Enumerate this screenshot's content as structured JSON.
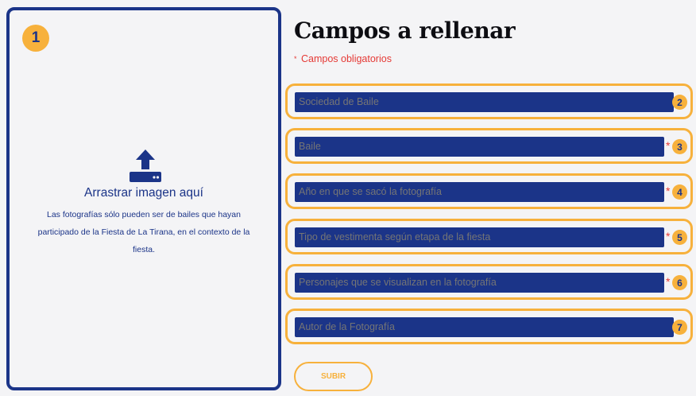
{
  "dropzone": {
    "step": "1",
    "icon": "upload-icon",
    "title": "Arrastrar imagen aquí",
    "hint": "Las fotografías sólo pueden ser de bailes que hayan participado de la Fiesta de La Tirana, en el contexto de la fiesta."
  },
  "form": {
    "title": "Campos a rellenar",
    "required_mark": "*",
    "required_note": "Campos obligatorios",
    "fields": [
      {
        "step": "2",
        "placeholder": "Sociedad de Baile",
        "required": false
      },
      {
        "step": "3",
        "placeholder": "Baile",
        "required": true
      },
      {
        "step": "4",
        "placeholder": "Año en que se sacó la fotografía",
        "required": true
      },
      {
        "step": "5",
        "placeholder": "Tipo de vestimenta según etapa de la fiesta",
        "required": true
      },
      {
        "step": "6",
        "placeholder": "Personajes que se visualizan en la fotografía",
        "required": true
      },
      {
        "step": "7",
        "placeholder": "Autor de la Fotografía",
        "required": false
      }
    ],
    "submit_label": "SUBIR"
  },
  "colors": {
    "navy": "#1b3488",
    "accent": "#f7b13c",
    "required": "#e53935",
    "background": "#f4f4f6"
  }
}
